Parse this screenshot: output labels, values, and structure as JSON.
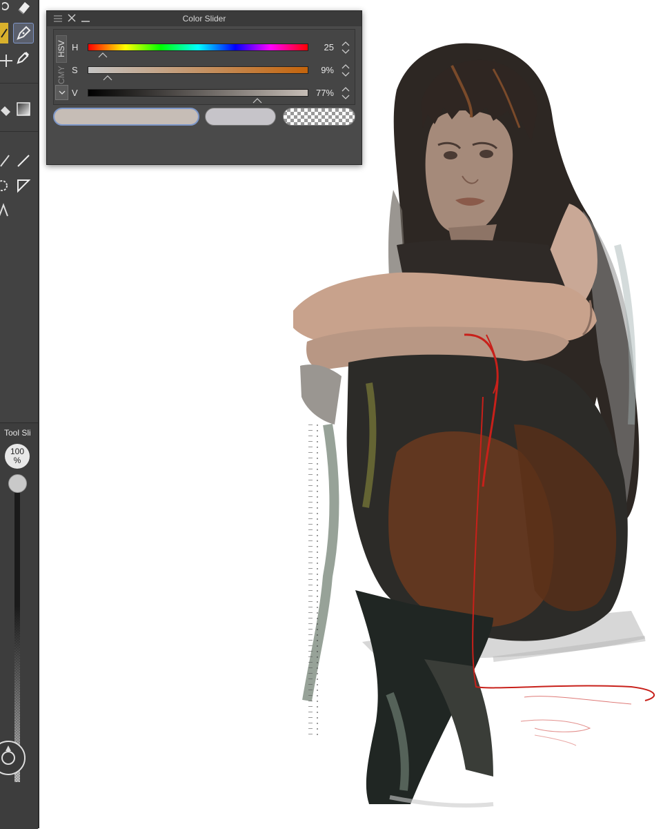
{
  "color_slider": {
    "title": "Color Slider",
    "tabs": [
      "HSV",
      "CMY"
    ],
    "sliders": [
      {
        "label": "H",
        "value": "25",
        "fraction": 0.07
      },
      {
        "label": "S",
        "value": "9%",
        "fraction": 0.09
      },
      {
        "label": "V",
        "value": "77%",
        "fraction": 0.77
      }
    ],
    "main_color": "#c6bdb6",
    "sub_color": "#c6c4c9"
  },
  "tool_slider": {
    "title": "Tool Sli",
    "size_value": "100",
    "size_unit": "%"
  },
  "toolbar": {
    "icons": [
      "eraser-icon",
      "pen-icon",
      "g-pen-icon",
      "move-icon",
      "dropper-icon",
      "fill-icon",
      "gradient-icon",
      "smudge-icon",
      "line-icon",
      "lasso-icon",
      "shape-icon",
      "text-icon"
    ]
  }
}
